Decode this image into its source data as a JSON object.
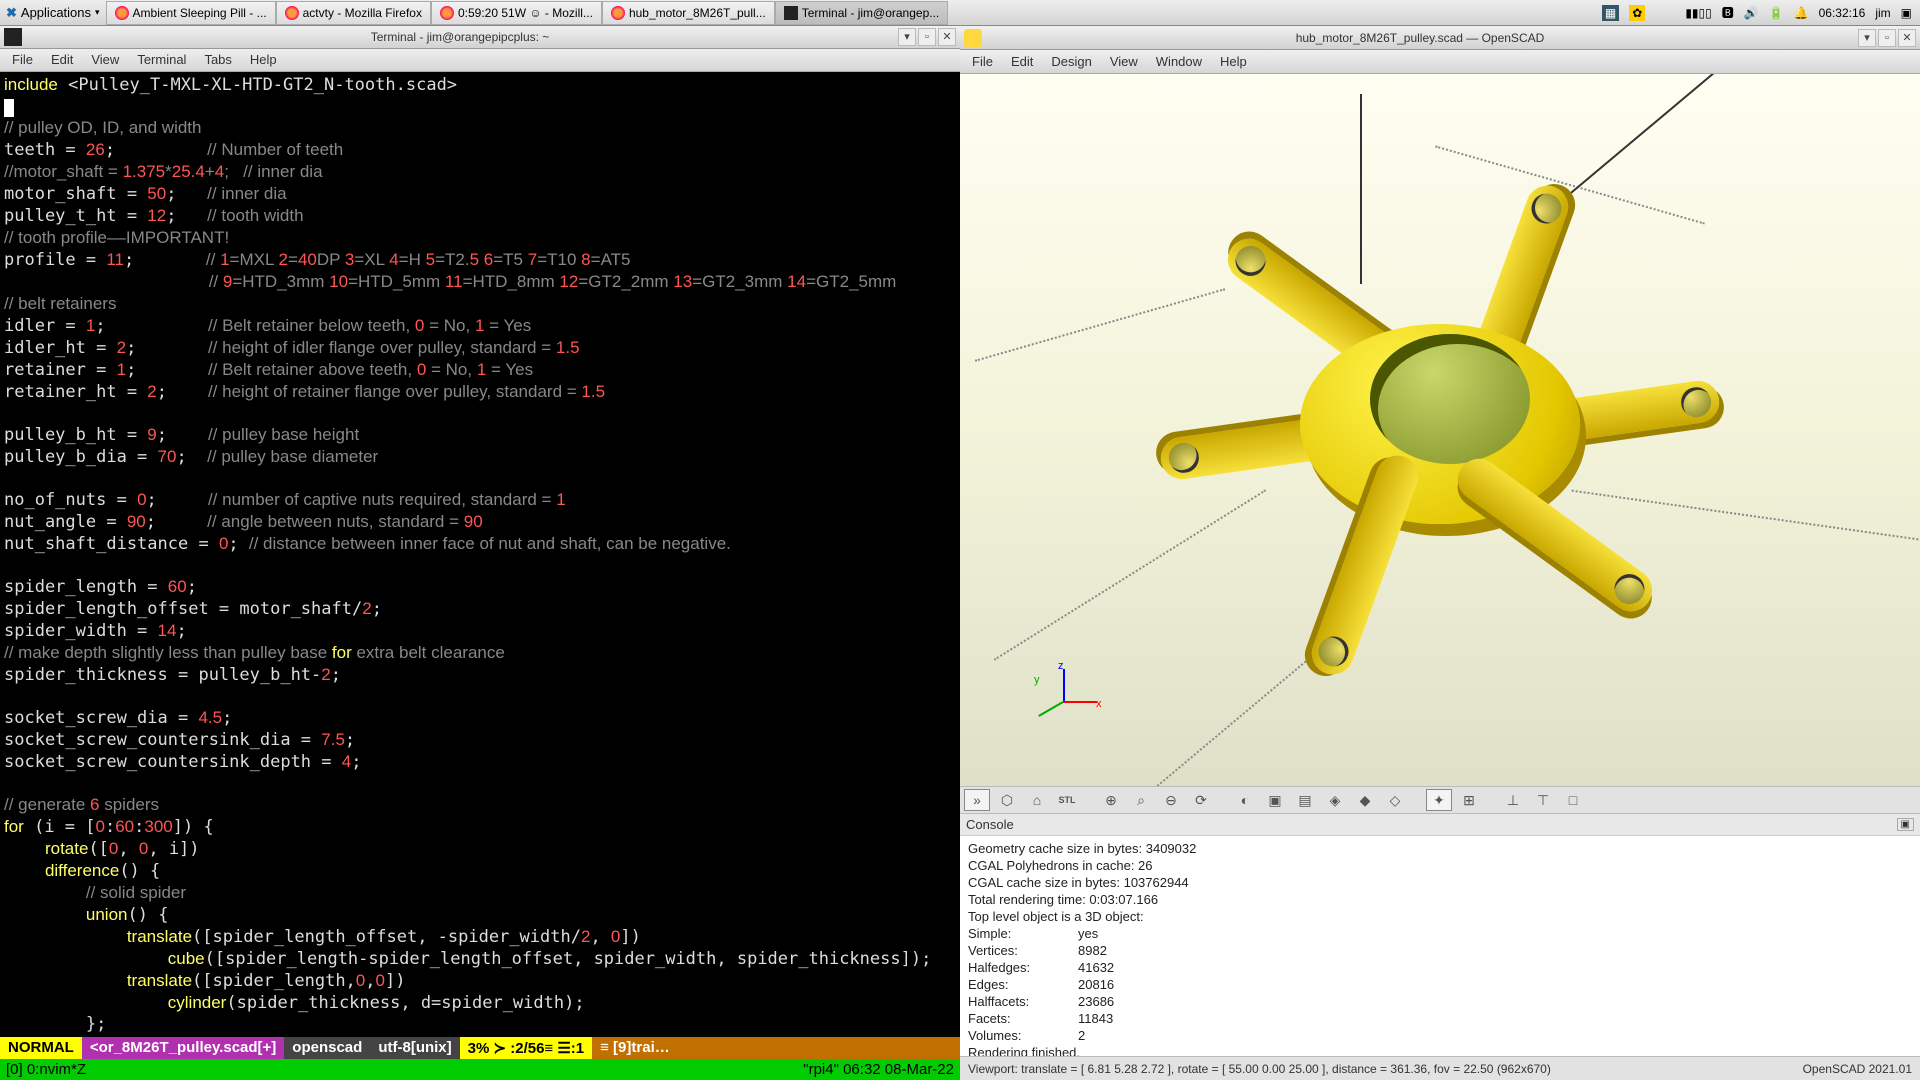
{
  "panel": {
    "applications": "Applications",
    "tasks": [
      {
        "icon": "ff",
        "label": "Ambient Sleeping Pill - ..."
      },
      {
        "icon": "ff",
        "label": "actvty - Mozilla Firefox"
      },
      {
        "icon": "ff",
        "label": "0:59:20 51W ☺ - Mozill..."
      },
      {
        "icon": "ff",
        "label": "hub_motor_8M26T_pull..."
      },
      {
        "icon": "term",
        "label": "Terminal - jim@orangep..."
      }
    ],
    "clock": "06:32:16",
    "user": "jim"
  },
  "term": {
    "title": "Terminal - jim@orangepipcplus: ~",
    "menus": [
      "File",
      "Edit",
      "View",
      "Terminal",
      "Tabs",
      "Help"
    ],
    "code_raw": "include <Pulley_T-MXL-XL-HTD-GT2_N-tooth.scad>\n▮\n// pulley OD, ID, and width\nteeth = 26;         // Number of teeth\n//motor_shaft = 1.375*25.4+4;   // inner dia\nmotor_shaft = 50;   // inner dia\npulley_t_ht = 12;   // tooth width\n// tooth profile––IMPORTANT!\nprofile = 11;       // 1=MXL 2=40DP 3=XL 4=H 5=T2.5 6=T5 7=T10 8=AT5\n                    // 9=HTD_3mm 10=HTD_5mm 11=HTD_8mm 12=GT2_2mm 13=GT2_3mm 14=GT2_5mm\n// belt retainers\nidler = 1;          // Belt retainer below teeth, 0 = No, 1 = Yes\nidler_ht = 2;       // height of idler flange over pulley, standard = 1.5\nretainer = 1;       // Belt retainer above teeth, 0 = No, 1 = Yes\nretainer_ht = 2;    // height of retainer flange over pulley, standard = 1.5\n\npulley_b_ht = 9;    // pulley base height\npulley_b_dia = 70;  // pulley base diameter\n\nno_of_nuts = 0;     // number of captive nuts required, standard = 1\nnut_angle = 90;     // angle between nuts, standard = 90\nnut_shaft_distance = 0; // distance between inner face of nut and shaft, can be negative.\n\nspider_length = 60;\nspider_length_offset = motor_shaft/2;\nspider_width = 14;\n// make depth slightly less than pulley base for extra belt clearance\nspider_thickness = pulley_b_ht-2;\n\nsocket_screw_dia = 4.5;\nsocket_screw_countersink_dia = 7.5;\nsocket_screw_countersink_depth = 4;\n\n// generate 6 spiders\nfor (i = [0:60:300]) {\n    rotate([0, 0, i])\n    difference() {\n        // solid spider\n        union() {\n            translate([spider_length_offset, -spider_width/2, 0])\n                cube([spider_length-spider_length_offset, spider_width, spider_thickness]);\n            translate([spider_length,0,0])\n                cylinder(spider_thickness, d=spider_width);\n        };",
    "status": {
      "mode": " NORMAL ",
      "file": "<or_8M26T_pulley.scad[+]",
      "ft": "openscad",
      "enc": "utf-8[unix]",
      "pct": "3% ≻ :2/56≡ ☰:1",
      "trail": "≡ [9]trai…"
    },
    "tmux": {
      "left": "[0] 0:nvim*Z",
      "right": "\"rpi4\" 06:32 08-Mar-22"
    }
  },
  "scad": {
    "title": "hub_motor_8M26T_pulley.scad — OpenSCAD",
    "menus": [
      "File",
      "Edit",
      "Design",
      "View",
      "Window",
      "Help"
    ],
    "console_header": "Console",
    "console": {
      "l1": "Geometry cache size in bytes: 3409032",
      "l2": "CGAL Polyhedrons in cache: 26",
      "l3": "CGAL cache size in bytes: 103762944",
      "l4": "Total rendering time: 0:03:07.166",
      "l5": "   Top level object is a 3D object:",
      "simple_k": "   Simple:",
      "simple_v": "yes",
      "vert_k": "   Vertices:",
      "vert_v": "8982",
      "he_k": "   Halfedges:",
      "he_v": "41632",
      "edge_k": "   Edges:",
      "edge_v": "20816",
      "hf_k": "   Halffacets:",
      "hf_v": "23686",
      "fc_k": "   Facets:",
      "fc_v": "11843",
      "vol_k": "   Volumes:",
      "vol_v": "2",
      "done": "Rendering finished."
    },
    "status_left": "Viewport: translate = [ 6.81 5.28 2.72 ], rotate = [ 55.00 0.00 25.00 ], distance = 361.36, fov = 22.50 (962x670)",
    "status_right": "OpenSCAD 2021.01",
    "tool_icons": [
      "»",
      "⬡",
      "⌂",
      "STL",
      "⊕",
      "⌕",
      "⊖",
      "⟳",
      "◐",
      "▣",
      "▤",
      "◈",
      "◆",
      "◇",
      "✦",
      "⊞",
      "⊥",
      "⊤",
      "□"
    ]
  }
}
